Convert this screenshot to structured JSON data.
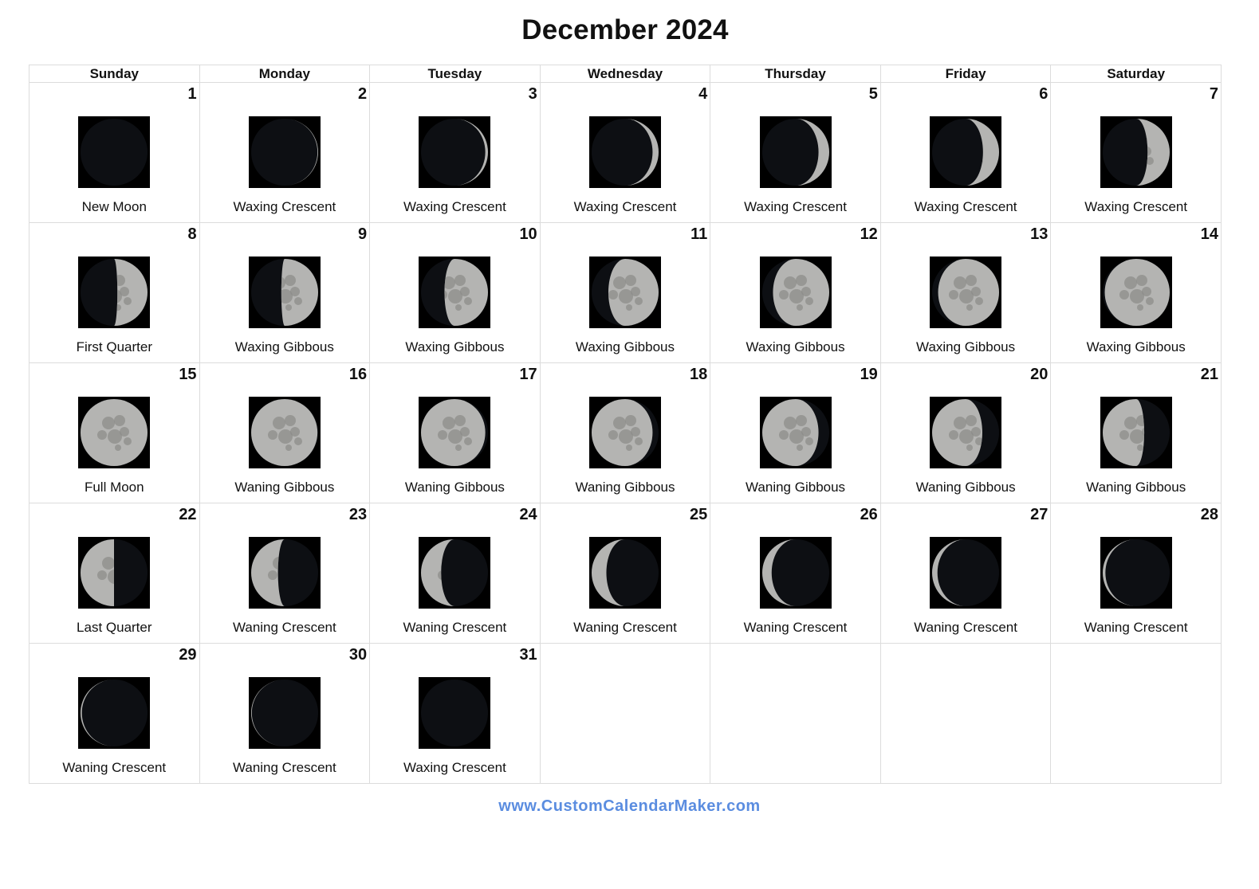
{
  "title": "December 2024",
  "weekdays": [
    "Sunday",
    "Monday",
    "Tuesday",
    "Wednesday",
    "Thursday",
    "Friday",
    "Saturday"
  ],
  "first_weekday_index": 0,
  "days": [
    {
      "day": "1",
      "phase": "New Moon",
      "illumination": 0.0,
      "waxing": true
    },
    {
      "day": "2",
      "phase": "Waxing Crescent",
      "illumination": 0.01,
      "waxing": true
    },
    {
      "day": "3",
      "phase": "Waxing Crescent",
      "illumination": 0.04,
      "waxing": true
    },
    {
      "day": "4",
      "phase": "Waxing Crescent",
      "illumination": 0.09,
      "waxing": true
    },
    {
      "day": "5",
      "phase": "Waxing Crescent",
      "illumination": 0.16,
      "waxing": true
    },
    {
      "day": "6",
      "phase": "Waxing Crescent",
      "illumination": 0.24,
      "waxing": true
    },
    {
      "day": "7",
      "phase": "Waxing Crescent",
      "illumination": 0.33,
      "waxing": true
    },
    {
      "day": "8",
      "phase": "First Quarter",
      "illumination": 0.45,
      "waxing": true
    },
    {
      "day": "9",
      "phase": "Waxing Gibbous",
      "illumination": 0.55,
      "waxing": true
    },
    {
      "day": "10",
      "phase": "Waxing Gibbous",
      "illumination": 0.65,
      "waxing": true
    },
    {
      "day": "11",
      "phase": "Waxing Gibbous",
      "illumination": 0.75,
      "waxing": true
    },
    {
      "day": "12",
      "phase": "Waxing Gibbous",
      "illumination": 0.84,
      "waxing": true
    },
    {
      "day": "13",
      "phase": "Waxing Gibbous",
      "illumination": 0.91,
      "waxing": true
    },
    {
      "day": "14",
      "phase": "Waxing Gibbous",
      "illumination": 0.97,
      "waxing": true
    },
    {
      "day": "15",
      "phase": "Full Moon",
      "illumination": 1.0,
      "waxing": false
    },
    {
      "day": "16",
      "phase": "Waning Gibbous",
      "illumination": 0.99,
      "waxing": false
    },
    {
      "day": "17",
      "phase": "Waning Gibbous",
      "illumination": 0.96,
      "waxing": false
    },
    {
      "day": "18",
      "phase": "Waning Gibbous",
      "illumination": 0.91,
      "waxing": false
    },
    {
      "day": "19",
      "phase": "Waning Gibbous",
      "illumination": 0.84,
      "waxing": false
    },
    {
      "day": "20",
      "phase": "Waning Gibbous",
      "illumination": 0.75,
      "waxing": false
    },
    {
      "day": "21",
      "phase": "Waning Gibbous",
      "illumination": 0.62,
      "waxing": false
    },
    {
      "day": "22",
      "phase": "Last Quarter",
      "illumination": 0.5,
      "waxing": false
    },
    {
      "day": "23",
      "phase": "Waning Crescent",
      "illumination": 0.4,
      "waxing": false
    },
    {
      "day": "24",
      "phase": "Waning Crescent",
      "illumination": 0.3,
      "waxing": false
    },
    {
      "day": "25",
      "phase": "Waning Crescent",
      "illumination": 0.22,
      "waxing": false
    },
    {
      "day": "26",
      "phase": "Waning Crescent",
      "illumination": 0.14,
      "waxing": false
    },
    {
      "day": "27",
      "phase": "Waning Crescent",
      "illumination": 0.08,
      "waxing": false
    },
    {
      "day": "28",
      "phase": "Waning Crescent",
      "illumination": 0.04,
      "waxing": false
    },
    {
      "day": "29",
      "phase": "Waning Crescent",
      "illumination": 0.02,
      "waxing": false
    },
    {
      "day": "30",
      "phase": "Waning Crescent",
      "illumination": 0.01,
      "waxing": false
    },
    {
      "day": "31",
      "phase": "Waxing Crescent",
      "illumination": 0.0,
      "waxing": true
    }
  ],
  "footer": "www.CustomCalendarMaker.com"
}
